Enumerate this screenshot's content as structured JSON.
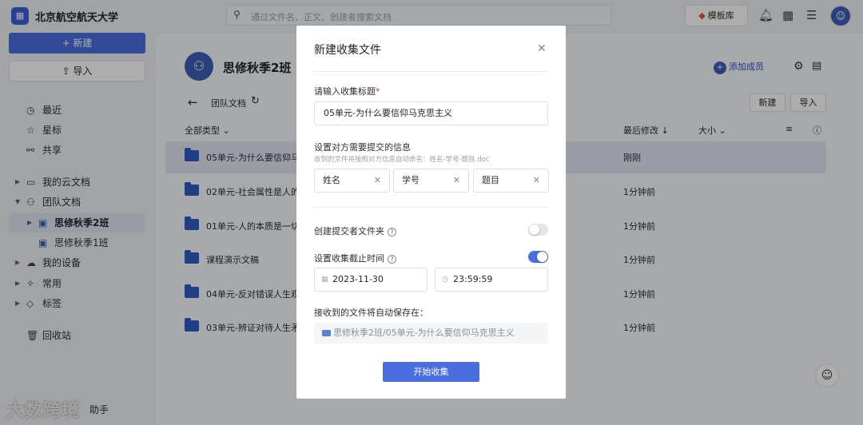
{
  "topbar": {
    "org_name": "北京航空航天大学",
    "search_placeholder": "通过文件名、正文、创建者搜索文档",
    "template_label": "模板库"
  },
  "sidebar": {
    "new_label": "+ 新建",
    "import_label": "导入",
    "items": [
      {
        "label": "最近",
        "icon": "clock-icon"
      },
      {
        "label": "星标",
        "icon": "star-icon"
      },
      {
        "label": "共享",
        "icon": "share-icon"
      },
      {
        "label": "我的云文档",
        "icon": "folder-icon"
      },
      {
        "label": "团队文档",
        "icon": "team-icon"
      },
      {
        "label": "思修秋季2班",
        "icon": "group-icon"
      },
      {
        "label": "思修秋季1班",
        "icon": "group-icon"
      },
      {
        "label": "我的设备",
        "icon": "cloud-icon"
      },
      {
        "label": "常用",
        "icon": "pin-icon"
      },
      {
        "label": "标签",
        "icon": "tag-icon"
      },
      {
        "label": "回收站",
        "icon": "trash-icon"
      }
    ],
    "bottom_text": "助手"
  },
  "main": {
    "team_title": "思修秋季2班",
    "add_member": "添加成员",
    "breadcrumb": "团队文档",
    "new_btn": "新建",
    "import_btn": "导入",
    "col_type": "全部类型",
    "col_modified": "最后修改 ↓",
    "col_size": "大小",
    "rows": [
      {
        "name": "05单元-为什么要信仰马",
        "time": "刚刚"
      },
      {
        "name": "02单元-社会属性是人的",
        "time": "1分钟前"
      },
      {
        "name": "01单元-人的本质是一切",
        "time": "1分钟前"
      },
      {
        "name": "课程演示文稿",
        "time": "1分钟前"
      },
      {
        "name": "04单元-反对错误人生观",
        "time": "1分钟前"
      },
      {
        "name": "03单元-辨证对待人生矛",
        "time": "1分钟前"
      }
    ]
  },
  "watermark": "大数跨境",
  "modal": {
    "title": "新建收集文件",
    "title_label": "请输入收集标题",
    "title_value": "05单元-为什么要信仰马克思主义",
    "info_label": "设置对方需要提交的信息",
    "info_hint": "收到的文件将按照对方信息自动命名：姓名-学号-题目.doc",
    "fields": [
      "姓名",
      "学号",
      "题目"
    ],
    "folder_label": "创建提交者文件夹",
    "folder_toggle": false,
    "deadline_label": "设置收集截止时间",
    "deadline_toggle": true,
    "date": "2023-11-30",
    "time": "23:59:59",
    "save_label": "接收到的文件将自动保存在：",
    "save_path": "思修秋季2班/05单元-为什么要信仰马克思主义",
    "start_label": "开始收集"
  }
}
